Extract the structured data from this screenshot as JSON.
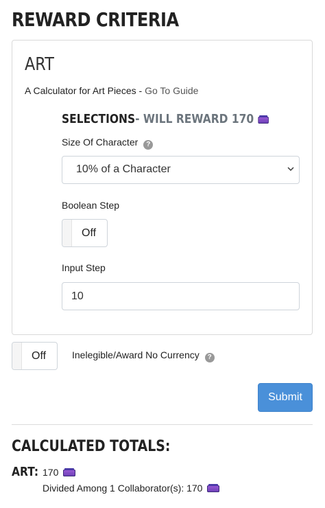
{
  "page": {
    "title": "REWARD CRITERIA"
  },
  "card": {
    "title": "ART",
    "subtitle": "A Calculator for Art Pieces",
    "separator": " - ",
    "guide_link": "Go To Guide"
  },
  "selections": {
    "heading": "SELECTIONS",
    "reward_text": " - WILL REWARD 170",
    "currency_icon": "currency-icon"
  },
  "fields": {
    "size_label": "Size Of Character",
    "size_value": "10% of a Character",
    "boolean_label": "Boolean Step",
    "boolean_value": "Off",
    "input_label": "Input Step",
    "input_value": "10"
  },
  "ineligible": {
    "toggle_value": "Off",
    "label": "Inelegible/Award No Currency"
  },
  "submit_label": "Submit",
  "totals": {
    "title": "CALCULATED TOTALS:",
    "art_label": "ART:",
    "art_value": "170",
    "divided_text": "Divided Among 1 Collaborator(s): 170"
  },
  "colors": {
    "primary_button": "#4a90d9",
    "currency_purple": "#7b4ec4",
    "muted_text": "#6c757d"
  }
}
